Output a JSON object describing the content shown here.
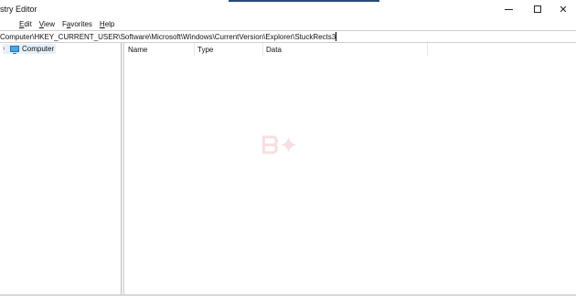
{
  "app": {
    "title": "stry Editor"
  },
  "window_controls": [
    "minimize-icon",
    "maximize-icon",
    "close-icon"
  ],
  "menu": [
    {
      "pre": "",
      "ul": "E",
      "post": "dit"
    },
    {
      "pre": "",
      "ul": "V",
      "post": "iew"
    },
    {
      "pre": "F",
      "ul": "a",
      "post": "vorites"
    },
    {
      "pre": "",
      "ul": "H",
      "post": "elp"
    }
  ],
  "address": {
    "path": "Computer\\HKEY_CURRENT_USER\\Software\\Microsoft\\Windows\\CurrentVersion\\Explorer\\StuckRects3"
  },
  "tree": {
    "expander": "›",
    "items": [
      {
        "label": "Computer",
        "icon": "computer-icon"
      }
    ]
  },
  "list": {
    "columns": [
      "Name",
      "Type",
      "Data"
    ],
    "rows": []
  },
  "close_glyph": "✕"
}
